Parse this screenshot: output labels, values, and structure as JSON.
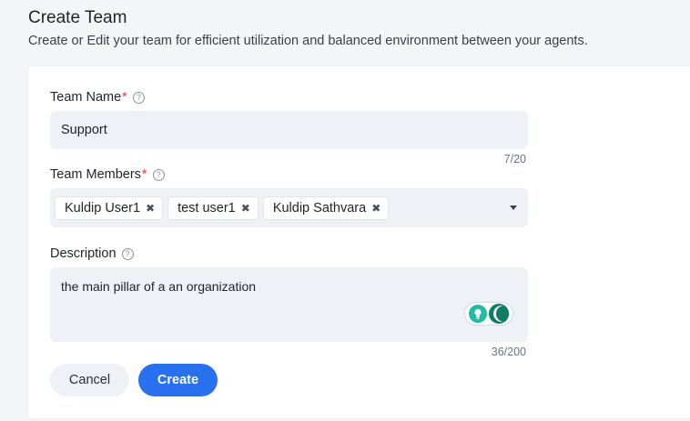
{
  "header": {
    "title": "Create Team",
    "subtitle": "Create or Edit your team for efficient utilization and balanced environment between your agents."
  },
  "form": {
    "team_name": {
      "label": "Team Name",
      "required_mark": "*",
      "value": "Support",
      "counter": "7/20"
    },
    "team_members": {
      "label": "Team Members",
      "required_mark": "*",
      "chips": [
        "Kuldip User1",
        "test user1",
        "Kuldip Sathvara"
      ]
    },
    "description": {
      "label": "Description",
      "value": "the main pillar of a an organization",
      "counter": "36/200"
    },
    "help_glyph": "?",
    "remove_glyph": "✖",
    "cancel_label": "Cancel",
    "create_label": "Create"
  },
  "colors": {
    "primary": "#2770f0",
    "required": "#e53935",
    "field_bg": "#eef1f5",
    "ai_green": "#1ebea5"
  }
}
